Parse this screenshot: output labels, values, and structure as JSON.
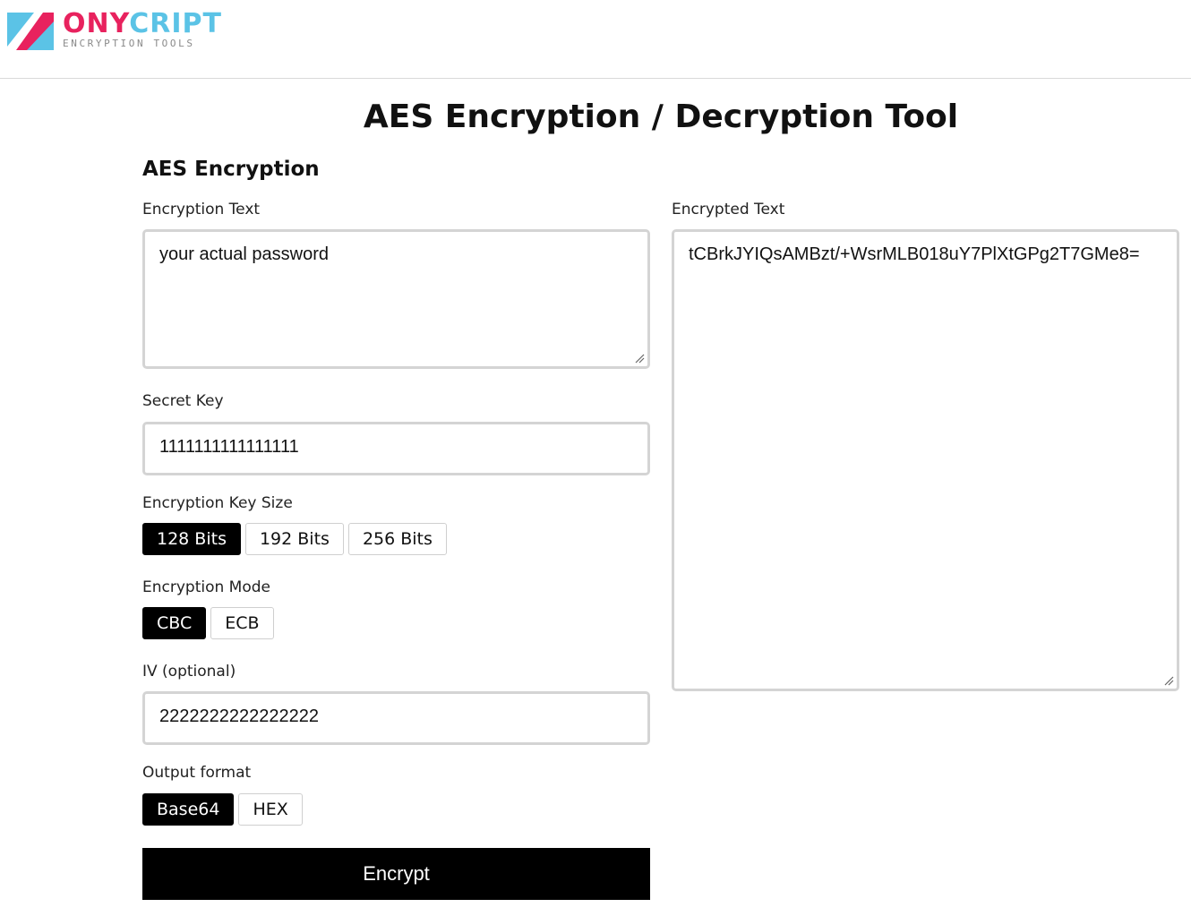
{
  "brand": {
    "name_part1": "ONY",
    "name_part2": "CRIPT",
    "tagline": "ENCRYPTION TOOLS",
    "pink": "#e8225e",
    "blue": "#5bc3e6"
  },
  "page_title": "AES Encryption / Decryption Tool",
  "section_title": "AES Encryption",
  "encryption_text": {
    "label": "Encryption Text",
    "value": "your actual password"
  },
  "secret_key": {
    "label": "Secret Key",
    "value": "1111111111111111"
  },
  "key_size": {
    "label": "Encryption Key Size",
    "options": [
      "128 Bits",
      "192 Bits",
      "256 Bits"
    ],
    "selected": "128 Bits"
  },
  "mode": {
    "label": "Encryption Mode",
    "options": [
      "CBC",
      "ECB"
    ],
    "selected": "CBC"
  },
  "iv": {
    "label": "IV (optional)",
    "value": "2222222222222222"
  },
  "output_format": {
    "label": "Output format",
    "options": [
      "Base64",
      "HEX"
    ],
    "selected": "Base64"
  },
  "encrypt_button": "Encrypt",
  "encrypted_text": {
    "label": "Encrypted Text",
    "value": "tCBrkJYIQsAMBzt/+WsrMLB018uY7PlXtGPg2T7GMe8="
  }
}
